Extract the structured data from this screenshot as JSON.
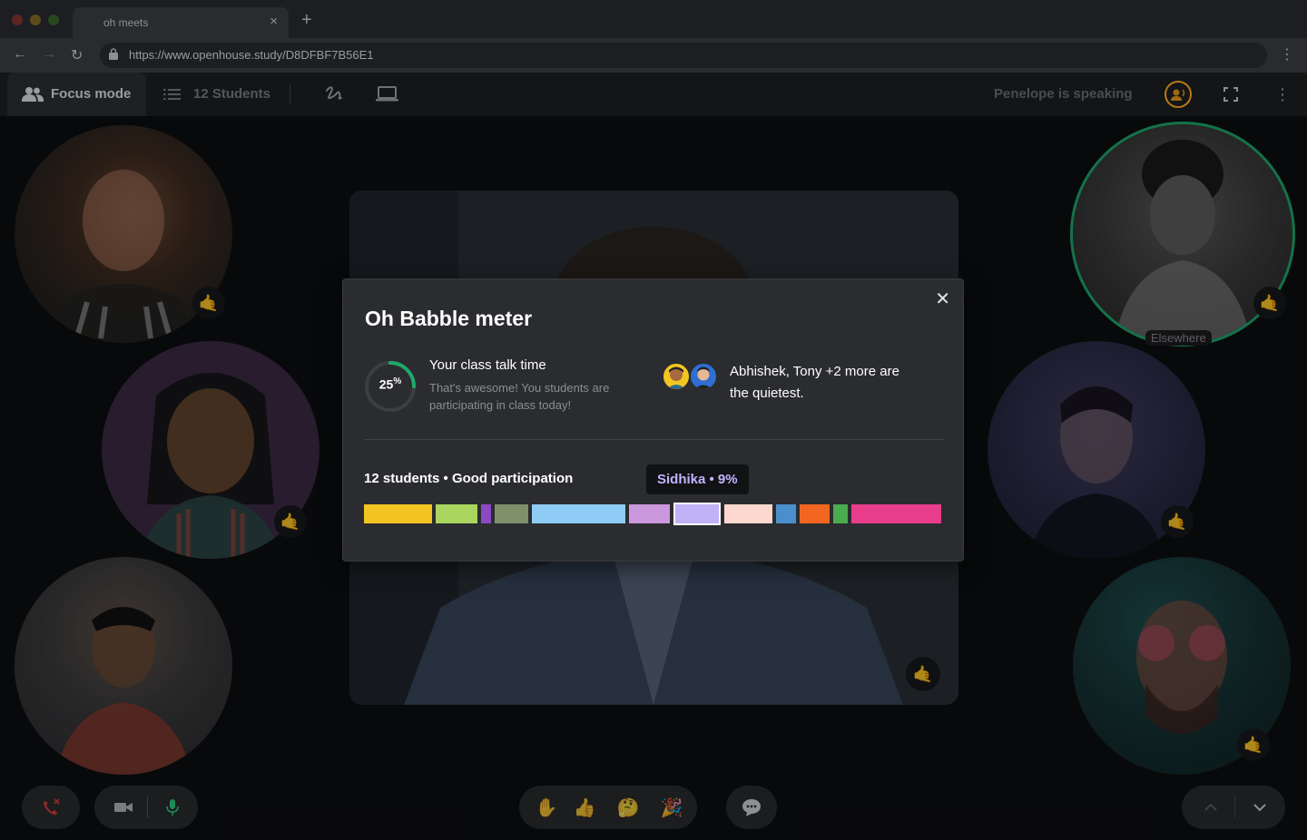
{
  "browser": {
    "tab_title": "oh meets",
    "tab_close": "×",
    "new_tab": "+",
    "url": "https://www.openhouse.study/D8DFBF7B56E1",
    "back": "←",
    "forward": "→",
    "reload": "↻",
    "menu": "⋮"
  },
  "toolbar": {
    "focus_mode_label": "Focus mode",
    "students_label": "12 Students",
    "speaking_label": "Penelope is speaking",
    "more": "⋮"
  },
  "participants": [
    {
      "id": "p1",
      "reaction": "🤙"
    },
    {
      "id": "p2",
      "reaction": "🤙"
    },
    {
      "id": "p3"
    },
    {
      "id": "p4",
      "reaction": "🤙",
      "status": "Elsewhere"
    },
    {
      "id": "p5",
      "reaction": "🤙"
    },
    {
      "id": "p6",
      "reaction": "🤙"
    },
    {
      "id": "main",
      "reaction": "🤙"
    }
  ],
  "modal": {
    "title": "Oh Babble meter",
    "close": "✕",
    "talk_time_value": "25",
    "talk_time_unit": "%",
    "talk_time_fraction": 0.25,
    "talk_time_title": "Your class talk time",
    "talk_time_desc": "That's awesome! You students are participating in class today!",
    "quiet_text": "Abhishek, Tony +2 more are the quietest.",
    "summary": "12 students • Good participation",
    "tooltip": "Sidhika • 9%",
    "segments": [
      {
        "color": "#f2c522"
      },
      {
        "color": "#a9d55f"
      },
      {
        "color": "#8b49c2"
      },
      {
        "color": "#7d906a"
      },
      {
        "color": "#8ecbf5"
      },
      {
        "color": "#cc98dd"
      },
      {
        "color": "#c1b1f7",
        "active": true
      },
      {
        "color": "#fdd8cf"
      },
      {
        "color": "#4a8fcb"
      },
      {
        "color": "#f26622"
      },
      {
        "color": "#4aac4e"
      },
      {
        "color": "#e83d8a"
      }
    ]
  },
  "controls": {
    "reactions": [
      "✋",
      "👍",
      "🤔",
      "🎉"
    ]
  },
  "colors": {
    "accent_green": "#1ea86b",
    "speaking_ring": "#b87a16",
    "tooltip_text": "#c2b3ff"
  }
}
